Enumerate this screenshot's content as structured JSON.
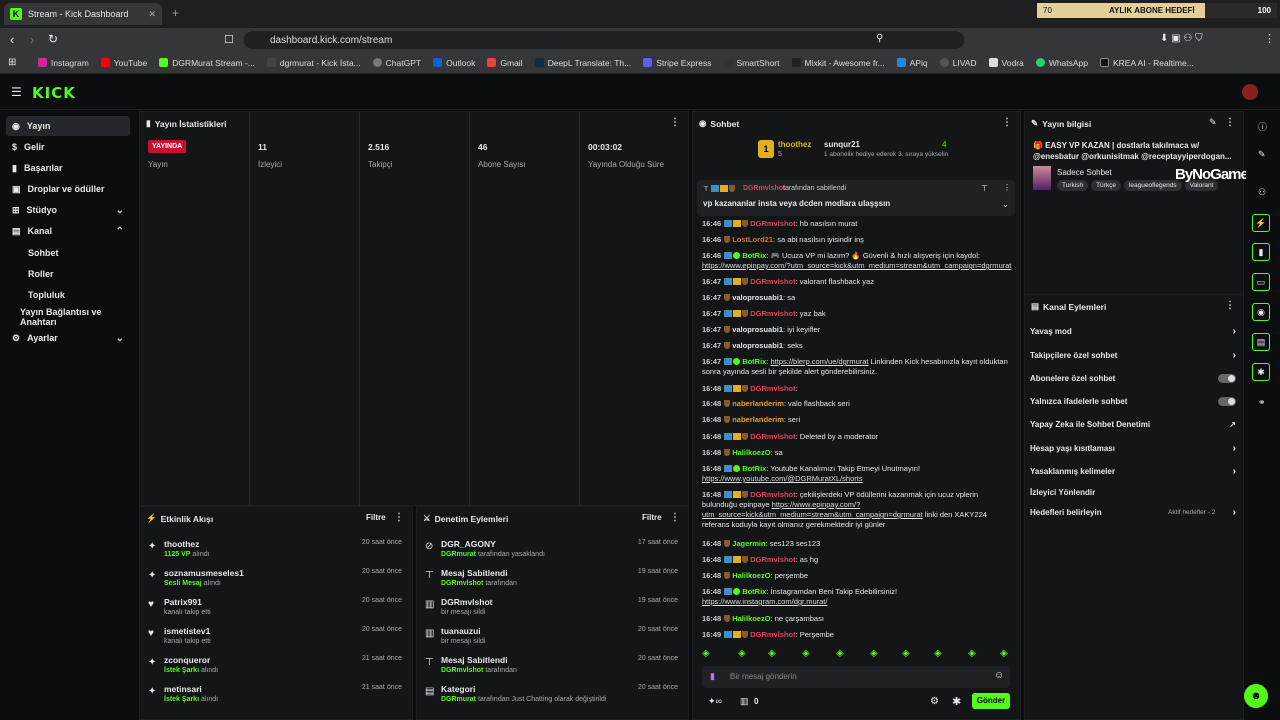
{
  "browser": {
    "tab_title": "Stream - Kick Dashboard",
    "url": "dashboard.kick.com/stream",
    "bookmarks": [
      "Instagram",
      "YouTube",
      "DGRMurat Stream -...",
      "dgrmurat - Kick İsta...",
      "ChatGPT",
      "Outlook",
      "Gmail",
      "DeepL Translate: Th...",
      "Stripe Express",
      "SmartShort",
      "Mixkit - Awesome fr...",
      "APiq",
      "LIVAD",
      "Vodra",
      "WhatsApp",
      "KREA AI - Realtime..."
    ],
    "goal": {
      "left": "70",
      "label": "AYLIK ABONE HEDEFİ",
      "right": "100",
      "progress": 0.7
    }
  },
  "brand": {
    "logo": "KICK"
  },
  "sidebar": {
    "items": [
      "Yayın",
      "Gelir",
      "Başarılar",
      "Droplar ve ödüller",
      "Stüdyo",
      "Kanal",
      "Sohbet",
      "Roller",
      "Topluluk",
      "Yayın Bağlantısı ve Anahtarı",
      "Ayarlar"
    ]
  },
  "stats": {
    "title": "Yayın İstatistikleri",
    "live_badge": "YAYINDA",
    "live_label": "Yayın",
    "items": [
      {
        "value": "11",
        "label": "İzleyici"
      },
      {
        "value": "2.516",
        "label": "Takipçi"
      },
      {
        "value": "46",
        "label": "Abone Sayısı"
      },
      {
        "value": "00:03:02",
        "label": "Yayında Olduğu Süre"
      }
    ]
  },
  "activity": {
    "title": "Etkinlik Akışı",
    "filter": "Filtre",
    "rows": [
      {
        "name": "thoothez",
        "sub": "1125 VP",
        "suffix": "alındı",
        "time": "20 saat önce"
      },
      {
        "name": "soznamusmeseles1",
        "sub": "Sesli Mesaj",
        "suffix": "alındı",
        "time": "20 saat önce"
      },
      {
        "name": "Patrix991",
        "sub": "",
        "suffix": "kanalı takip etti",
        "time": "20 saat önce"
      },
      {
        "name": "ismetistev1",
        "sub": "",
        "suffix": "kanalı takip etti",
        "time": "20 saat önce"
      },
      {
        "name": "zconqueror",
        "sub": "İstek Şarkı",
        "suffix": "alındı",
        "time": "21 saat önce"
      },
      {
        "name": "metinsari",
        "sub": "İstek Şarkı",
        "suffix": "alındı",
        "time": "21 saat önce"
      }
    ]
  },
  "moderation": {
    "title": "Denetim Eylemleri",
    "filter": "Filtre",
    "rows": [
      {
        "name": "DGR_AGONY",
        "sub": "DGRmurat",
        "suffix": "tarafından yasaklandı",
        "time": "17 saat önce"
      },
      {
        "name": "Mesaj Sabitlendi",
        "sub": "DGRmvlshot",
        "suffix": "tarafından",
        "time": "19 saat önce"
      },
      {
        "name": "DGRmvlshot",
        "sub": "",
        "suffix": "bir mesajı sildi",
        "time": "19 saat önce"
      },
      {
        "name": "tuanauzui",
        "sub": "",
        "suffix": "bir mesajı sildi",
        "time": "20 saat önce"
      },
      {
        "name": "Mesaj Sabitlendi",
        "sub": "DGRmvlshot",
        "suffix": "tarafından",
        "time": "20 saat önce"
      },
      {
        "name": "Kategori",
        "sub": "DGRmurat",
        "suffix": "tarafından Just Chatting olarak değiştirildi",
        "time": "20 saat önce"
      }
    ]
  },
  "chat": {
    "title": "Sohbet",
    "top_user": "thoothez",
    "top_count": "5",
    "gift_user": "sunqur21",
    "gift_count": "4",
    "gift_text": "1 aboneli̇k hediye ederek 3. sıraya yükselin",
    "pinned_by": "DGRmvlshot",
    "pinned_suffix": "tarafından sabitlendi",
    "pinned_msg": "vp kazananlar insta veya dcden modlara ulaşşsın",
    "messages": [
      {
        "t": "16:46",
        "u": "DGRmvlshot",
        "c": "#e04060",
        "m": ": hb nasılsın murat"
      },
      {
        "t": "16:46",
        "u": "LostLord21",
        "c": "#e07030",
        "m": ": sa abi nasılsın iyisindir inş"
      },
      {
        "t": "16:46",
        "u": "BotRix",
        "c": "#53fc18",
        "m": ": 🎮 Ucuza VP mi lazım? 🔥 Güvenli & hızlı alışveriş için kaydol: https://www.epinpay.com/?utm_source=kick&utm_medium=stream&utm_campaign=dgrmurat"
      },
      {
        "t": "16:47",
        "u": "DGRmvlshot",
        "c": "#e04060",
        "m": ": valorant flashback yaz"
      },
      {
        "t": "16:47",
        "u": "valoprosuabi1",
        "c": "#e8e8e8",
        "m": ": sa"
      },
      {
        "t": "16:47",
        "u": "DGRmvlshot",
        "c": "#e04060",
        "m": ": yaz bak"
      },
      {
        "t": "16:47",
        "u": "valoprosuabi1",
        "c": "#e8e8e8",
        "m": ": iyi keyifler"
      },
      {
        "t": "16:47",
        "u": "valoprosuabi1",
        "c": "#e8e8e8",
        "m": ": seks"
      },
      {
        "t": "16:47",
        "u": "BotRix",
        "c": "#53fc18",
        "m": ": https://blerp.com/ue/dgrmurat Linkinden Kick hesabınızla kayıt olduktan sonra yayında sesli bir şekilde alert gönderebilirsiniz."
      },
      {
        "t": "16:48",
        "u": "DGRmvlshot",
        "c": "#e04060",
        "m": ":"
      },
      {
        "t": "16:48",
        "u": "naberlanderim",
        "c": "#e0a030",
        "m": ": valo flashback seri"
      },
      {
        "t": "16:48",
        "u": "naberlanderim",
        "c": "#e0a030",
        "m": ": seri"
      },
      {
        "t": "16:48",
        "u": "DGRmvlshot",
        "c": "#e04060",
        "m": ": Deleted by a moderator"
      },
      {
        "t": "16:48",
        "u": "HalilkoezO",
        "c": "#53fc18",
        "m": ": sa"
      },
      {
        "t": "16:48",
        "u": "BotRix",
        "c": "#53fc18",
        "m": ": Youtube Kanalımızı Takip Etmeyi Unutmayın! https://www.youtube.com/@DGRMuratXL/shorts"
      },
      {
        "t": "16:48",
        "u": "DGRmvlshot",
        "c": "#e04060",
        "m": ": çekilişlerdeki VP ödüllerini kazanmak için ucuz vplerin bulunduğu epinpaye https://www.epinpay.com/?utm_source=kick&utm_medium=stream&utm_campaign=dgrmurat linki den XAKY224 referans koduyla kayıt olmanız gerekmektedir iyi günler"
      },
      {
        "t": "16:48",
        "u": "Jagermin",
        "c": "#53fc18",
        "m": ": ses123 ses123"
      },
      {
        "t": "16:48",
        "u": "DGRmvlshot",
        "c": "#e04060",
        "m": ": as hg"
      },
      {
        "t": "16:48",
        "u": "HalilkoezO",
        "c": "#53fc18",
        "m": ": perşembe"
      },
      {
        "t": "16:48",
        "u": "BotRix",
        "c": "#53fc18",
        "m": ": İnstagramdan Beni Takip Edebilirsiniz! https://www.instagram.com/dgr.murat/"
      },
      {
        "t": "16:48",
        "u": "HalilkoezO",
        "c": "#53fc18",
        "m": ": ne çarşambası"
      },
      {
        "t": "16:49",
        "u": "DGRmvlshot",
        "c": "#e04060",
        "m": ": Perşembe"
      }
    ],
    "placeholder": "Bir mesaj gönderin",
    "count": "0",
    "send": "Gönder"
  },
  "stream_info": {
    "title": "Yayın bilgisi",
    "stream_title": "🎁 EASY VP KAZAN | dostlarla takılmaca w/ @enesbatur @orkunisitmak @receptayyiperdogan...",
    "chat_mode": "Sadece Sohbet",
    "tags": [
      "Turkish",
      "Türkçe",
      "leagueoflegends",
      "Valorant"
    ],
    "watermark": "ByNoGame"
  },
  "channel_actions": {
    "title": "Kanal Eylemleri",
    "items": [
      "Yavaş mod",
      "Takipçilere özel sohbet",
      "Abonelere özel sohbet",
      "Yalnızca ifadelerle sohbet",
      "Yapay Zeka ile Sohbet Denetimi",
      "Hesap yaşı kısıtlaması",
      "Yasaklanmış kelimeler",
      "İzleyici Yönlendir",
      "Hedefleri belirleyin"
    ],
    "goals_status": "Aktif hedefler - 2"
  }
}
